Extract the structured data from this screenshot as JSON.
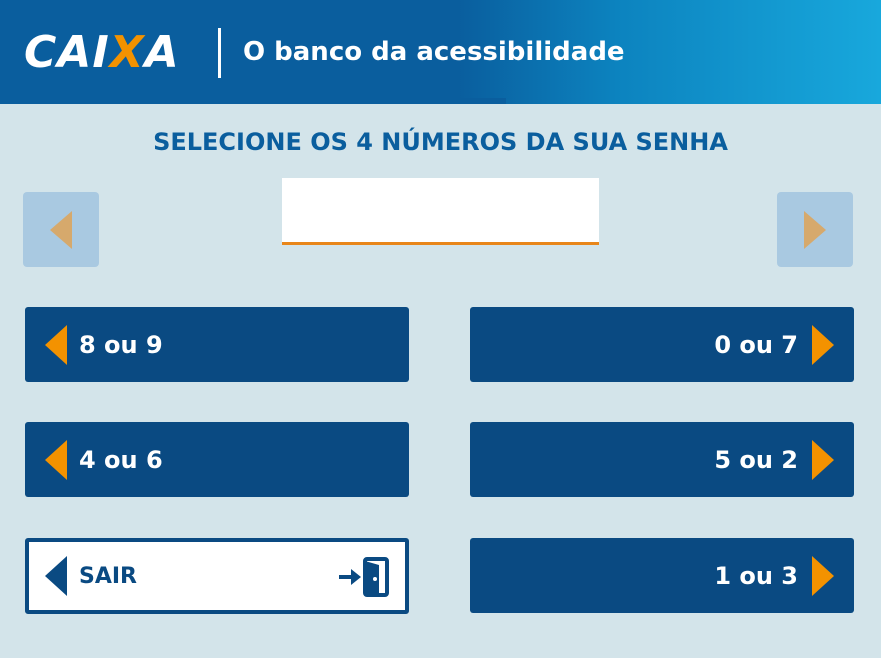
{
  "header": {
    "logo_part1": "CAI",
    "logo_x": "X",
    "logo_part2": "A",
    "slogan": "O banco da acessibilidade"
  },
  "title": "SELECIONE OS 4 NÚMEROS DA SUA SENHA",
  "options_left": [
    {
      "label": "8 ou 9"
    },
    {
      "label": "4 ou 6"
    }
  ],
  "options_right": [
    {
      "label": "0 ou 7"
    },
    {
      "label": "5 ou 2"
    },
    {
      "label": "1 ou 3"
    }
  ],
  "exit": {
    "label": "SAIR"
  },
  "colors": {
    "brand_blue": "#0a5e9e",
    "button_blue": "#0a4a82",
    "accent_orange": "#f39200",
    "background": "#d3e4ea"
  },
  "icons": {
    "nav_left": "arrow-left-icon",
    "nav_right": "arrow-right-icon",
    "exit": "exit-door-icon"
  }
}
